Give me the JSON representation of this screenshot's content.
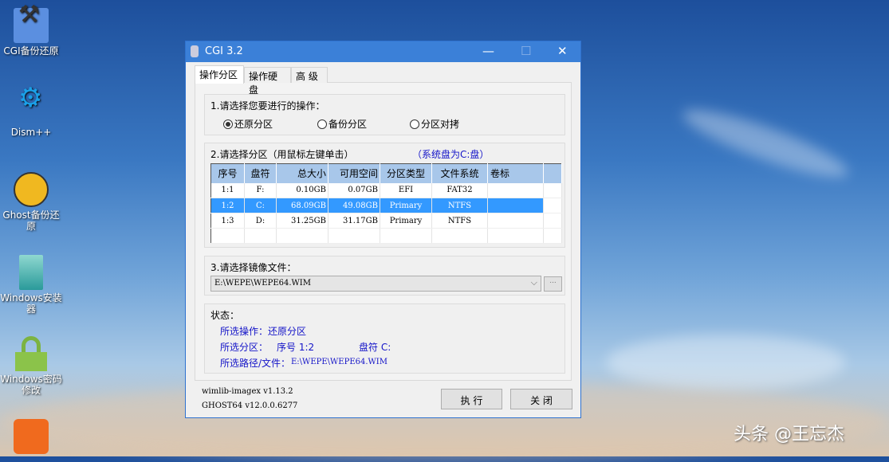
{
  "desktop": {
    "icons": [
      {
        "label": "CGI备份还原"
      },
      {
        "label": "Dism++"
      },
      {
        "label": "Ghost备份还原"
      },
      {
        "label": "Windows安装器"
      },
      {
        "label": "Windows密码修改"
      },
      {
        "label": ""
      }
    ],
    "watermark": "头条 @王忘杰"
  },
  "window": {
    "title": "CGI 3.2",
    "minimize": "—",
    "maximize": "☐",
    "close": "✕"
  },
  "tabs": [
    {
      "label": "操作分区",
      "active": true
    },
    {
      "label": "操作硬盘"
    },
    {
      "label": "高 级"
    }
  ],
  "operation": {
    "label": "1.请选择您要进行的操作：",
    "options": [
      {
        "label": "还原分区",
        "checked": true
      },
      {
        "label": "备份分区",
        "checked": false
      },
      {
        "label": "分区对拷",
        "checked": false
      }
    ]
  },
  "partition": {
    "label": "2.请选择分区（用鼠标左键单击）",
    "note": "（系统盘为C:盘）",
    "columns": [
      "序号",
      "盘符",
      "总大小",
      "可用空间",
      "分区类型",
      "文件系统",
      "卷标"
    ],
    "rows": [
      [
        "1:1",
        "F:",
        "0.10GB",
        "0.07GB",
        "EFI",
        "FAT32",
        ""
      ],
      [
        "1:2",
        "C:",
        "68.09GB",
        "49.08GB",
        "Primary",
        "NTFS",
        ""
      ],
      [
        "1:3",
        "D:",
        "31.25GB",
        "31.17GB",
        "Primary",
        "NTFS",
        ""
      ]
    ],
    "selected_row": 1
  },
  "image": {
    "label": "3.请选择镜像文件：",
    "value": "E:\\WEPE\\WEPE64.WIM",
    "browse": "..."
  },
  "status": {
    "label": "状态：",
    "op": "所选操作：还原分区",
    "part_prefix": "所选分区：",
    "part_index": "序号 1:2",
    "part_drive": "盘符 C:",
    "path_prefix": "所选路径/文件：",
    "path": "E:\\WEPE\\WEPE64.WIM"
  },
  "footer": {
    "version1": "wimlib-imagex v1.13.2",
    "version2": "GHOST64 v12.0.0.6277",
    "execute": "执 行",
    "close": "关 闭"
  },
  "colors": {
    "titlebar": "#3b80d8",
    "selection": "#3399ff",
    "status_text": "#1414c8"
  }
}
